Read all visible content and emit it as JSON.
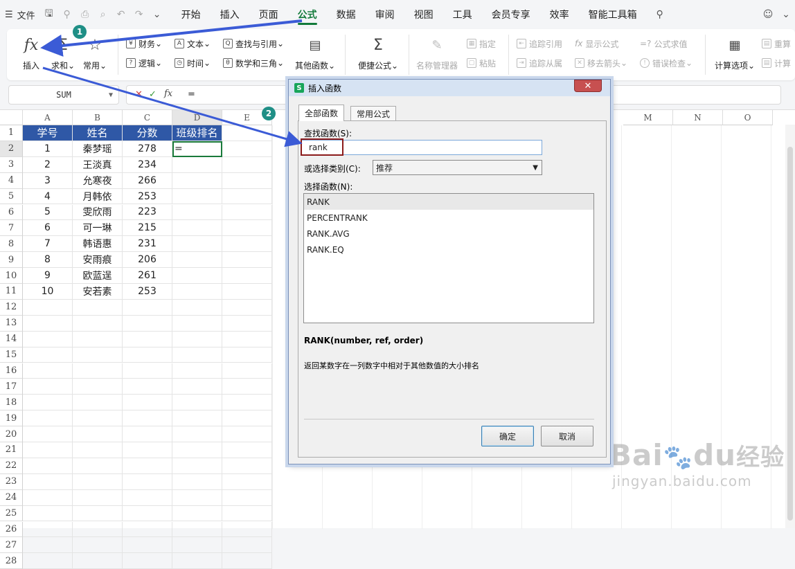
{
  "menubar": {
    "menu_label": "文件",
    "tabs": [
      {
        "label": "开始",
        "active": false
      },
      {
        "label": "插入",
        "active": false
      },
      {
        "label": "页面",
        "active": false
      },
      {
        "label": "公式",
        "active": true
      },
      {
        "label": "数据",
        "active": false
      },
      {
        "label": "审阅",
        "active": false
      },
      {
        "label": "视图",
        "active": false
      },
      {
        "label": "工具",
        "active": false
      },
      {
        "label": "会员专享",
        "active": false
      },
      {
        "label": "效率",
        "active": false
      },
      {
        "label": "智能工具箱",
        "active": false
      }
    ]
  },
  "ribbon": {
    "insert_label": "插入",
    "sum_label": "求和",
    "common_label": "常用",
    "finance": "财务",
    "text": "文本",
    "lookup": "查找与引用",
    "logic": "逻辑",
    "time": "时间",
    "math": "数学和三角",
    "other": "其他函数",
    "quick": "便捷公式",
    "name_mgr": "名称管理器",
    "specify": "指定",
    "paste": "粘贴",
    "trace_prec": "追踪引用",
    "trace_dep": "追踪从属",
    "show_formula": "显示公式",
    "remove_arrows": "移去箭头",
    "eval_formula": "公式求值",
    "error_check": "错误检查",
    "calc_opts": "计算选项",
    "recalc": "重算",
    "calc2": "计算"
  },
  "formula_bar": {
    "name_box": "SUM",
    "content": "="
  },
  "columns": [
    "A",
    "B",
    "C",
    "D",
    "E",
    "M",
    "N",
    "O"
  ],
  "table": {
    "headers": [
      "学号",
      "姓名",
      "分数",
      "班级排名"
    ],
    "rows": [
      [
        "1",
        "秦梦瑶",
        "278",
        "="
      ],
      [
        "2",
        "王淡真",
        "234",
        ""
      ],
      [
        "3",
        "允寒夜",
        "266",
        ""
      ],
      [
        "4",
        "月韩依",
        "253",
        ""
      ],
      [
        "5",
        "雯欣雨",
        "223",
        ""
      ],
      [
        "6",
        "可一琳",
        "215",
        ""
      ],
      [
        "7",
        "韩语惠",
        "231",
        ""
      ],
      [
        "8",
        "安雨痕",
        "206",
        ""
      ],
      [
        "9",
        "欧蓝逞",
        "261",
        ""
      ],
      [
        "10",
        "安若素",
        "253",
        ""
      ]
    ]
  },
  "row_numbers": [
    "1",
    "2",
    "3",
    "4",
    "5",
    "6",
    "7",
    "8",
    "9",
    "10",
    "11",
    "12",
    "13",
    "14",
    "15",
    "16",
    "17",
    "18",
    "19",
    "20",
    "21",
    "22",
    "23",
    "24",
    "25",
    "26",
    "27",
    "28"
  ],
  "dialog": {
    "icon_letter": "S",
    "title": "插入函数",
    "tab_all": "全部函数",
    "tab_common": "常用公式",
    "search_label": "查找函数(S):",
    "search_value": "rank",
    "category_label": "或选择类别(C):",
    "category_value": "推荐",
    "list_label": "选择函数(N):",
    "functions": [
      "RANK",
      "PERCENTRANK",
      "RANK.AVG",
      "RANK.EQ"
    ],
    "signature": "RANK(number, ref, order)",
    "description": "返回某数字在一列数字中相对于其他数值的大小排名",
    "ok": "确定",
    "cancel": "取消"
  },
  "badges": [
    "1",
    "2"
  ],
  "watermark": {
    "brand": "Bai",
    "brand_suffix": "du",
    "product": "经验",
    "url": "jingyan.baidu.com"
  },
  "colors": {
    "accent": "#127a3a",
    "header_fill": "#2f58a6",
    "arrow": "#3b5bd6",
    "badge": "#1f8f86",
    "highlight_box": "#8b1a1a"
  }
}
